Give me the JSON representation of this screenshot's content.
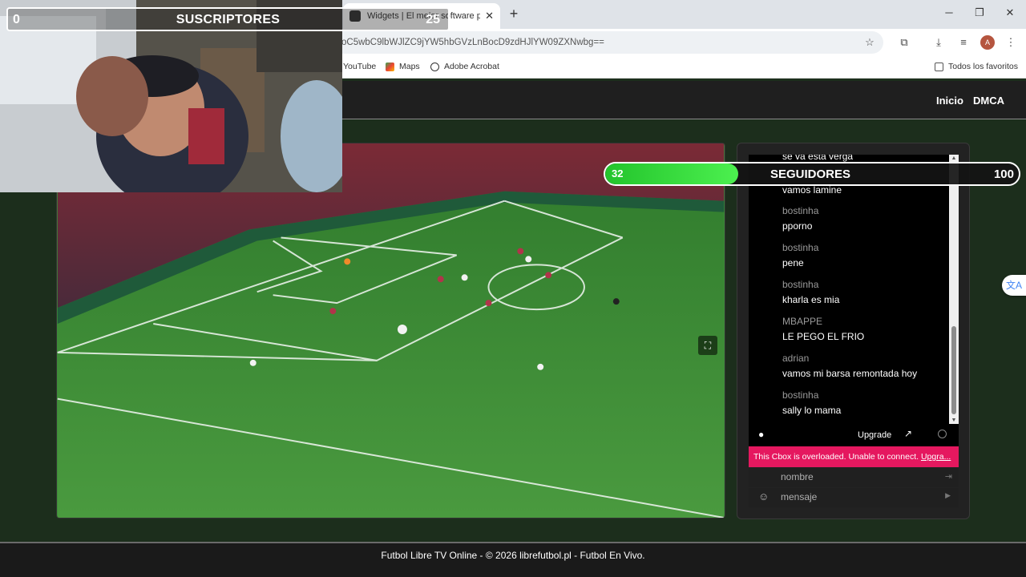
{
  "browser": {
    "tab_title": "Widgets | El mejor software par",
    "url": "oC5wbC9lbWJlZC9jYW5hbGVzLnBocD9zdHJlYW09ZXNwbg==",
    "bookmarks": [
      "YouTube",
      "Maps",
      "Adobe Acrobat"
    ],
    "all_bookmarks": "Todos los favoritos",
    "avatar_letter": "A"
  },
  "site": {
    "nav": [
      "Inicio",
      "DMCA"
    ],
    "footer": "Futbol Libre TV Online - © 2026 librefutbol.pl - Futbol En Vivo."
  },
  "chat": {
    "partial_top": "se va esta verga",
    "partial_top2": "vamos lamine",
    "messages": [
      {
        "user": "bostinha",
        "text": "pporno"
      },
      {
        "user": "bostinha",
        "text": "pene"
      },
      {
        "user": "bostinha",
        "text": "kharla es mia"
      },
      {
        "user": "MBAPPE",
        "text": "LE PEGO EL FRIO"
      },
      {
        "user": "adrian",
        "text": "vamos mi barsa remontada hoy"
      },
      {
        "user": "bostinha",
        "text": "sally lo mama"
      }
    ],
    "upgrade": "Upgrade",
    "alert": "This Cbox is overloaded. Unable to connect.",
    "alert_link": "Upgra...",
    "name_placeholder": "nombre",
    "message_placeholder": "mensaje"
  },
  "overlay": {
    "subs": {
      "current": "0",
      "label": "SUSCRIPTORES",
      "goal": "25"
    },
    "followers": {
      "current": "32",
      "label": "SEGUIDORES",
      "goal": "100",
      "progress_percent": 32
    }
  },
  "colors": {
    "alert": "#e5185f",
    "follower_fill": "#3ddc3f",
    "page_bg": "#1c2e1c"
  }
}
